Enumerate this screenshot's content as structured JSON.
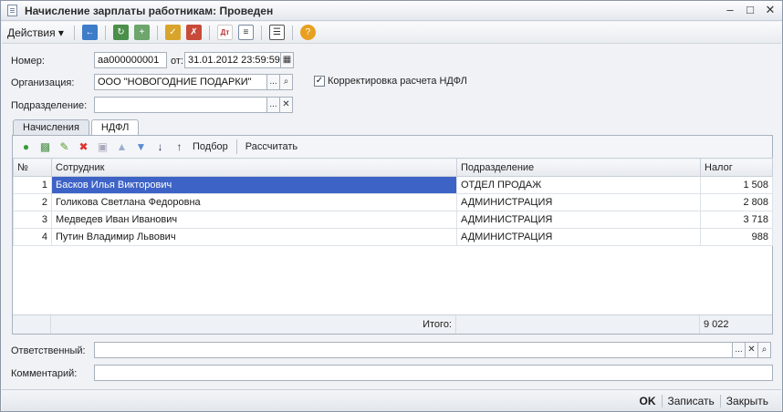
{
  "window": {
    "title": "Начисление зарплаты работникам: Проведен"
  },
  "toolbar": {
    "actions_label": "Действия"
  },
  "form": {
    "number_label": "Номер:",
    "number_value": "аа000000001",
    "date_label": "от:",
    "date_value": "31.01.2012 23:59:59",
    "org_label": "Организация:",
    "org_value": "ООО \"НОВОГОДНИЕ ПОДАРКИ\"",
    "ndfl_check_label": "Корректировка расчета НДФЛ",
    "division_label": "Подразделение:",
    "division_value": "",
    "responsible_label": "Ответственный:",
    "responsible_value": "",
    "comment_label": "Комментарий:",
    "comment_value": ""
  },
  "tabs": [
    "Начисления",
    "НДФЛ"
  ],
  "panel_toolbar": {
    "select_label": "Подбор",
    "calc_label": "Рассчитать"
  },
  "table": {
    "headers": {
      "num": "№",
      "employee": "Сотрудник",
      "division": "Подразделение",
      "tax": "Налог"
    },
    "rows": [
      {
        "num": "1",
        "employee": "Басков Илья Викторович",
        "division": "ОТДЕЛ ПРОДАЖ",
        "tax": "1 508"
      },
      {
        "num": "2",
        "employee": "Голикова Светлана Федоровна",
        "division": "АДМИНИСТРАЦИЯ",
        "tax": "2 808"
      },
      {
        "num": "3",
        "employee": "Медведев Иван Иванович",
        "division": "АДМИНИСТРАЦИЯ",
        "tax": "3 718"
      },
      {
        "num": "4",
        "employee": "Путин Владимир Львович",
        "division": "АДМИНИСТРАЦИЯ",
        "tax": "988"
      }
    ],
    "total_label": "Итого:",
    "total_value": "9 022"
  },
  "bottom": {
    "ok_label": "OK",
    "save_label": "Записать",
    "close_label": "Закрыть"
  },
  "colors": {
    "selection": "#3e63c6",
    "window_bg": "#f0f2f5"
  }
}
